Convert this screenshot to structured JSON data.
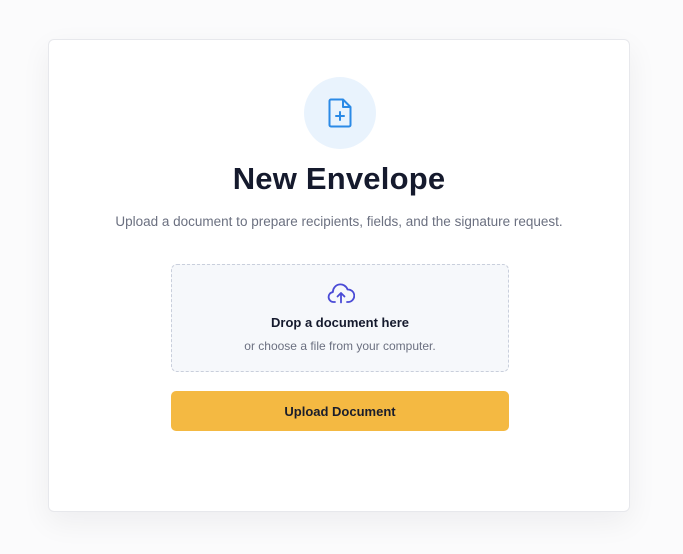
{
  "envelope": {
    "icon": "file-plus-icon",
    "title": "New Envelope",
    "subtitle": "Upload a document to prepare recipients, fields, and the signature request."
  },
  "dropzone": {
    "icon": "cloud-upload-icon",
    "title": "Drop a document here",
    "subtitle": "or choose a file from your computer."
  },
  "actions": {
    "upload_label": "Upload Document"
  },
  "colors": {
    "accent": "#f4b942",
    "icon_blue": "#2b8ae6",
    "cloud_indigo": "#4a4bd6"
  }
}
